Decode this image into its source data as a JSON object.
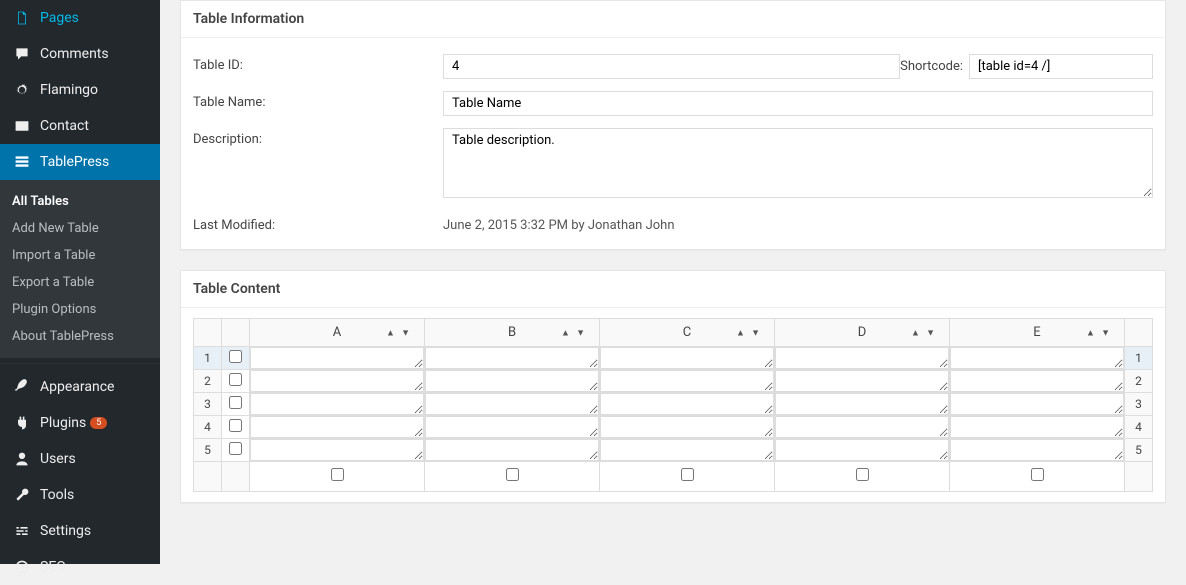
{
  "sidebar": {
    "items": [
      {
        "label": "Pages",
        "icon": "pages"
      },
      {
        "label": "Comments",
        "icon": "comments"
      },
      {
        "label": "Flamingo",
        "icon": "flamingo"
      },
      {
        "label": "Contact",
        "icon": "contact"
      },
      {
        "label": "TablePress",
        "icon": "tablepress"
      },
      {
        "label": "Appearance",
        "icon": "appearance"
      },
      {
        "label": "Plugins",
        "icon": "plugins",
        "badge": "5"
      },
      {
        "label": "Users",
        "icon": "users"
      },
      {
        "label": "Tools",
        "icon": "tools"
      },
      {
        "label": "Settings",
        "icon": "settings"
      },
      {
        "label": "SEO",
        "icon": "seo"
      }
    ],
    "submenu": [
      {
        "label": "All Tables"
      },
      {
        "label": "Add New Table"
      },
      {
        "label": "Import a Table"
      },
      {
        "label": "Export a Table"
      },
      {
        "label": "Plugin Options"
      },
      {
        "label": "About TablePress"
      }
    ]
  },
  "info": {
    "heading": "Table Information",
    "id_label": "Table ID:",
    "id_value": "4",
    "shortcode_label": "Shortcode:",
    "shortcode_value": "[table id=4 /]",
    "name_label": "Table Name:",
    "name_value": "Table Name",
    "desc_label": "Description:",
    "desc_value": "Table description.",
    "modified_label": "Last Modified:",
    "modified_value": "June 2, 2015 3:32 PM by Jonathan John"
  },
  "content": {
    "heading": "Table Content",
    "columns": [
      "A",
      "B",
      "C",
      "D",
      "E"
    ],
    "rows": [
      1,
      2,
      3,
      4,
      5
    ]
  }
}
